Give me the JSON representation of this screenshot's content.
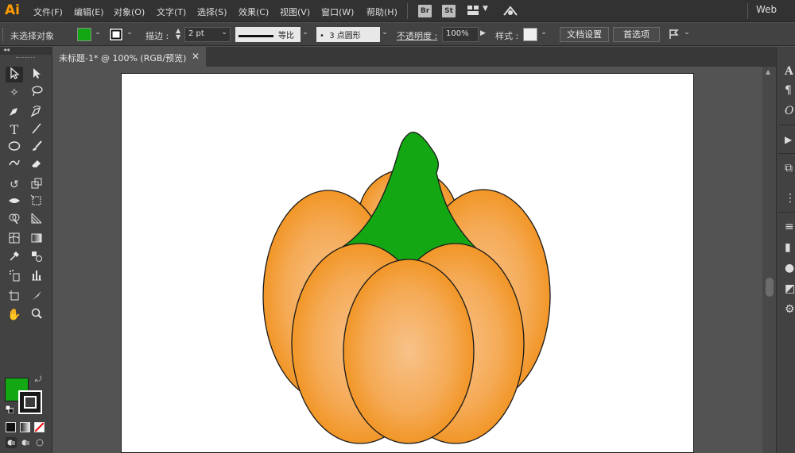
{
  "app": {
    "logo": "Ai"
  },
  "menu": {
    "items": [
      "文件(F)",
      "编辑(E)",
      "对象(O)",
      "文字(T)",
      "选择(S)",
      "效果(C)",
      "视图(V)",
      "窗口(W)",
      "帮助(H)"
    ],
    "bridge": "Br",
    "stock": "St",
    "workspace": "Web"
  },
  "control_bar": {
    "selection_status": "未选择对象",
    "fill_color": "#14a714",
    "stroke_label": "描边",
    "stroke_weight": "2 pt",
    "stroke_profile": "等比",
    "brush": "3 点圆形",
    "opacity_label": "不透明度",
    "opacity_value": "100%",
    "style_label": "样式",
    "doc_setup": "文档设置",
    "preferences": "首选项"
  },
  "document": {
    "tab_title": "未标题-1* @ 100% (RGB/预览)"
  },
  "toolbar": {
    "fill_color": "#14a714",
    "stroke_color": "#1a1a1a"
  },
  "artwork": {
    "pumpkin_orange": "#f39a2e",
    "pumpkin_highlight": "#f7c28a",
    "stem_green": "#14a714"
  }
}
